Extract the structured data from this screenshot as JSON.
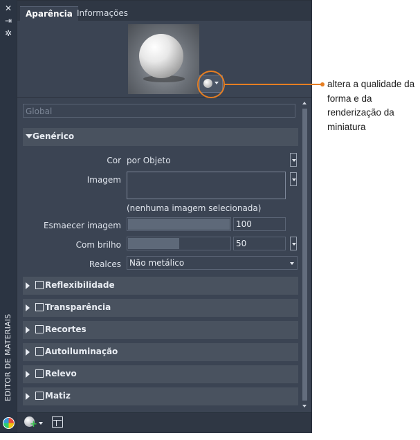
{
  "strip": {
    "title": "EDITOR DE MATERIAIS",
    "icons": [
      "close-icon",
      "pin-icon",
      "properties-icon",
      "palette-icon"
    ]
  },
  "tabs": [
    {
      "label": "Aparência",
      "active": true
    },
    {
      "label": "Informações",
      "active": false
    }
  ],
  "material_name_placeholder": "Global",
  "sections": {
    "generic": {
      "label": "Genérico",
      "expanded": true
    },
    "collapsed": [
      {
        "label": "Reflexibilidade"
      },
      {
        "label": "Transparência"
      },
      {
        "label": "Recortes"
      },
      {
        "label": "Autoiluminação"
      },
      {
        "label": "Relevo"
      },
      {
        "label": "Matiz"
      }
    ]
  },
  "properties": {
    "color": {
      "label": "Cor",
      "value": "por Objeto"
    },
    "image": {
      "label": "Imagem",
      "note": "(nenhuma imagem selecionada)"
    },
    "image_fade": {
      "label": "Esmaecer imagem",
      "value": "100",
      "fraction": 1.0
    },
    "glossiness": {
      "label": "Com brilho",
      "value": "50",
      "fraction": 0.5
    },
    "highlights": {
      "label": "Realces",
      "value": "Não metálico"
    }
  },
  "annotation": {
    "text": "altera a qualidade da forma e da renderização da miniatura",
    "color": "#e67e22"
  },
  "colors": {
    "panel_bg": "#3b4453",
    "section_bg": "#49525f",
    "strip_bg": "#2b3442"
  }
}
